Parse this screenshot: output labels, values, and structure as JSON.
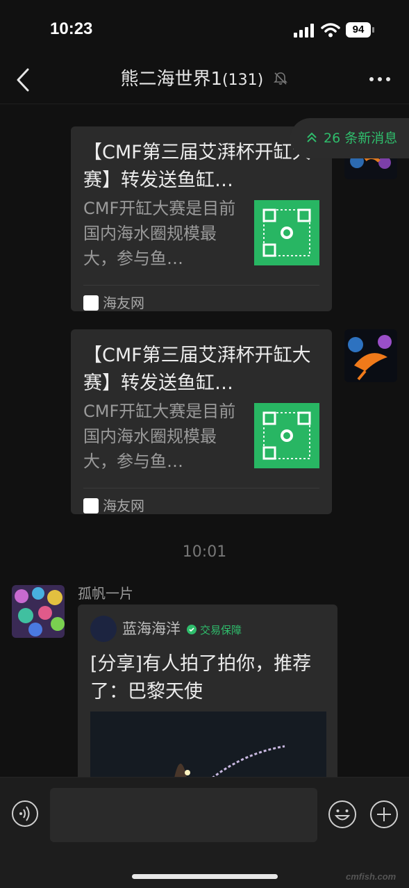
{
  "status_bar": {
    "time": "10:23",
    "battery": "94"
  },
  "nav": {
    "title": "熊二海世界1",
    "member_count": "(131)"
  },
  "new_messages": {
    "label": "26 条新消息"
  },
  "cards": [
    {
      "title": "【CMF第三届艾湃杯开缸大赛】转发送鱼缸…",
      "description": "CMF开缸大赛是目前国内海水圈规模最大，参与鱼…",
      "source": "海友网"
    },
    {
      "title": "【CMF第三届艾湃杯开缸大赛】转发送鱼缸…",
      "description": "CMF开缸大赛是目前国内海水圈规模最大，参与鱼…",
      "source": "海友网"
    }
  ],
  "timestamp": "10:01",
  "sender": {
    "name": "孤帆一片"
  },
  "share": {
    "account": "蓝海海洋",
    "badge": "交易保障",
    "title": "[分享]有人拍了拍你，推荐了：巴黎天使"
  },
  "input": {
    "placeholder": ""
  },
  "watermark": "cmfish.com",
  "colors": {
    "accent_green": "#2fbd6c",
    "background": "#111111",
    "card": "#2b2b2b"
  },
  "icons": [
    "back-icon",
    "mute-icon",
    "more-icon",
    "chevron-up-icon",
    "voice-icon",
    "emoji-icon",
    "plus-icon"
  ]
}
